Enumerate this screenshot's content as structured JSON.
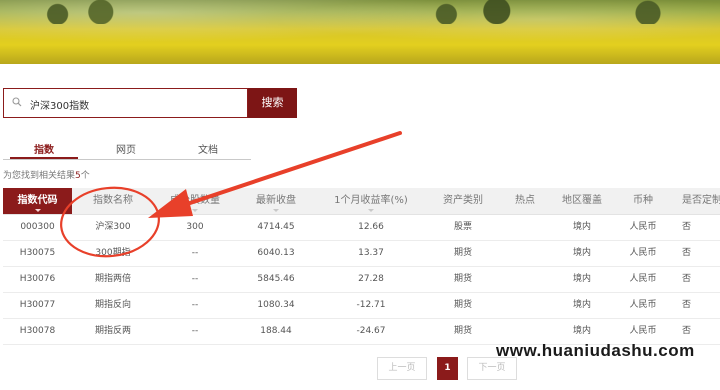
{
  "search": {
    "value": "沪深300指数",
    "button_label": "搜索"
  },
  "tabs": [
    {
      "label": "指数",
      "active": true
    },
    {
      "label": "网页",
      "active": false
    },
    {
      "label": "文档",
      "active": false
    }
  ],
  "result_summary": {
    "prefix": "为您找到相关结果",
    "count": "5",
    "suffix": "个"
  },
  "table": {
    "columns": [
      "指数代码",
      "指数名称",
      "成分股数量",
      "最新收盘",
      "1个月收益率(%)",
      "资产类别",
      "热点",
      "地区覆盖",
      "币种",
      "是否定制"
    ],
    "rows": [
      [
        "000300",
        "沪深300",
        "300",
        "4714.45",
        "12.66",
        "股票",
        "",
        "境内",
        "人民币",
        "否"
      ],
      [
        "H30075",
        "300期指",
        "--",
        "6040.13",
        "13.37",
        "期货",
        "",
        "境内",
        "人民币",
        "否"
      ],
      [
        "H30076",
        "期指两倍",
        "--",
        "5845.46",
        "27.28",
        "期货",
        "",
        "境内",
        "人民币",
        "否"
      ],
      [
        "H30077",
        "期指反向",
        "--",
        "1080.34",
        "-12.71",
        "期货",
        "",
        "境内",
        "人民币",
        "否"
      ],
      [
        "H30078",
        "期指反两",
        "--",
        "188.44",
        "-24.67",
        "期货",
        "",
        "境内",
        "人民币",
        "否"
      ]
    ]
  },
  "pagination": {
    "prev_label": "上一页",
    "current_page": "1",
    "next_label": "下一页"
  },
  "watermark": "www.huaniudashu.com",
  "colors": {
    "accent": "#8b1b1b",
    "annotation": "#e8402a"
  }
}
